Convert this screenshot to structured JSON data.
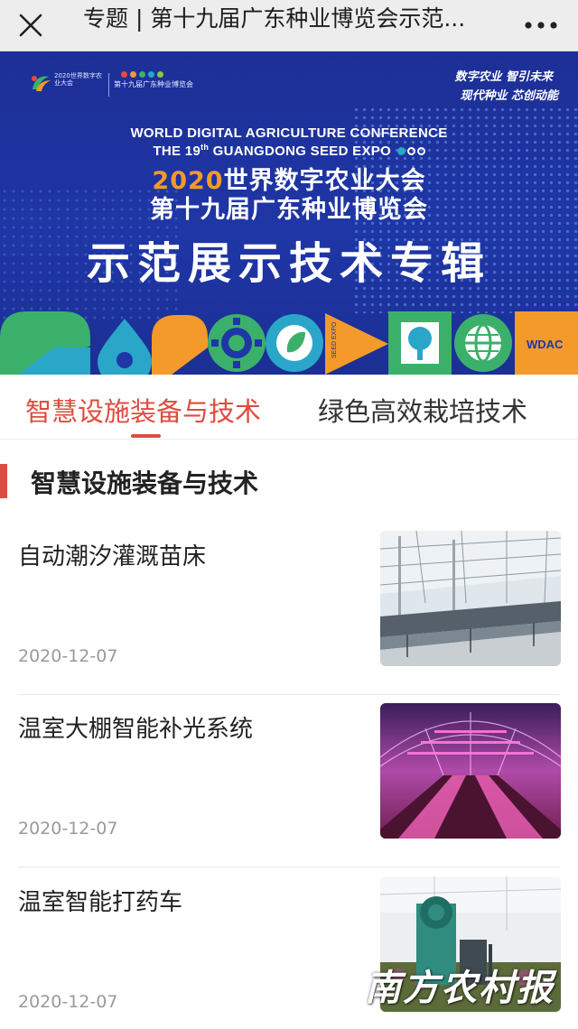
{
  "header": {
    "title": "专题 | 第十九届广东种业博览会示范..."
  },
  "banner": {
    "logo_left_text": "2020世界数字农业大会",
    "logo_right_text": "第十九届广东种业博览会",
    "slogan_line1": "数字农业 智引未来",
    "slogan_line2": "现代种业 芯创动能",
    "english_line1": "WORLD DIGITAL AGRICULTURE CONFERENCE",
    "english_line2_prefix": "THE 19",
    "english_line2_sup": "th",
    "english_line2_suffix": " GUANGDONG SEED EXPO",
    "cn_year": "2020",
    "cn_line1_rest": "世界数字农业大会",
    "cn_line2": "第十九届广东种业博览会",
    "cn_line3": "示范展示技术专辑",
    "seed_expo_label": "SEED EXPO",
    "wdac_label": "WDAC",
    "colors": {
      "navy": "#1f36a6",
      "orange": "#f39a2b",
      "green": "#3bb06a",
      "teal": "#2aa6c9"
    }
  },
  "tabs": [
    {
      "label": "智慧设施装备与技术",
      "active": true
    },
    {
      "label": "绿色高效栽培技术",
      "active": false
    }
  ],
  "section": {
    "title": "智慧设施装备与技术"
  },
  "articles": [
    {
      "title": "自动潮汐灌溉苗床",
      "date": "2020-12-07",
      "thumb": "greenhouse-beds-photo"
    },
    {
      "title": "温室大棚智能补光系统",
      "date": "2020-12-07",
      "thumb": "purple-grow-light-photo"
    },
    {
      "title": "温室智能打药车",
      "date": "2020-12-07",
      "thumb": "spray-cart-photo"
    }
  ],
  "watermark": "南方农村报",
  "icons": [
    "close-icon",
    "more-icon"
  ],
  "accent_color": "#dd4c3f"
}
